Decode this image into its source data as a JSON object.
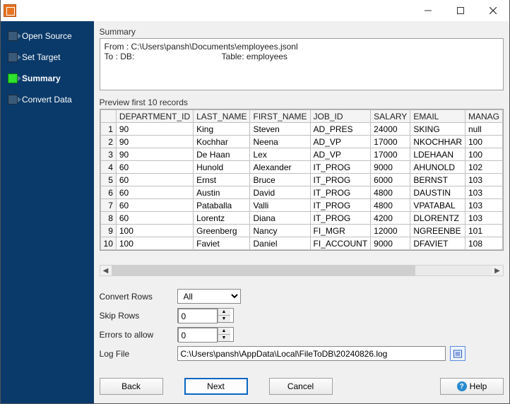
{
  "window": {
    "title": ""
  },
  "sidebar": {
    "steps": [
      {
        "label": "Open Source",
        "active": false
      },
      {
        "label": "Set Target",
        "active": false
      },
      {
        "label": "Summary",
        "active": true
      },
      {
        "label": "Convert Data",
        "active": false
      }
    ]
  },
  "summary": {
    "heading": "Summary",
    "from_label": "From : C:\\Users\\pansh\\Documents\\employees.jsonl",
    "to_label": "To : DB:",
    "table_label": "Table: employees"
  },
  "preview": {
    "heading": "Preview first 10 records",
    "columns": [
      "DEPARTMENT_ID",
      "LAST_NAME",
      "FIRST_NAME",
      "JOB_ID",
      "SALARY",
      "EMAIL",
      "MANAG"
    ],
    "rows": [
      [
        "90",
        "King",
        "Steven",
        "AD_PRES",
        "24000",
        "SKING",
        "null"
      ],
      [
        "90",
        "Kochhar",
        "Neena",
        "AD_VP",
        "17000",
        "NKOCHHAR",
        "100"
      ],
      [
        "90",
        "De Haan",
        "Lex",
        "AD_VP",
        "17000",
        "LDEHAAN",
        "100"
      ],
      [
        "60",
        "Hunold",
        "Alexander",
        "IT_PROG",
        "9000",
        "AHUNOLD",
        "102"
      ],
      [
        "60",
        "Ernst",
        "Bruce",
        "IT_PROG",
        "6000",
        "BERNST",
        "103"
      ],
      [
        "60",
        "Austin",
        "David",
        "IT_PROG",
        "4800",
        "DAUSTIN",
        "103"
      ],
      [
        "60",
        "Pataballa",
        "Valli",
        "IT_PROG",
        "4800",
        "VPATABAL",
        "103"
      ],
      [
        "60",
        "Lorentz",
        "Diana",
        "IT_PROG",
        "4200",
        "DLORENTZ",
        "103"
      ],
      [
        "100",
        "Greenberg",
        "Nancy",
        "FI_MGR",
        "12000",
        "NGREENBE",
        "101"
      ],
      [
        "100",
        "Faviet",
        "Daniel",
        "FI_ACCOUNT",
        "9000",
        "DFAVIET",
        "108"
      ]
    ]
  },
  "form": {
    "convert_rows": {
      "label": "Convert Rows",
      "value": "All"
    },
    "skip_rows": {
      "label": "Skip Rows",
      "value": "0"
    },
    "errors_allow": {
      "label": "Errors to allow",
      "value": "0"
    },
    "log_file": {
      "label": "Log File",
      "value": "C:\\Users\\pansh\\AppData\\Local\\FileToDB\\20240826.log"
    }
  },
  "buttons": {
    "back": "Back",
    "next": "Next",
    "cancel": "Cancel",
    "help": "Help"
  }
}
